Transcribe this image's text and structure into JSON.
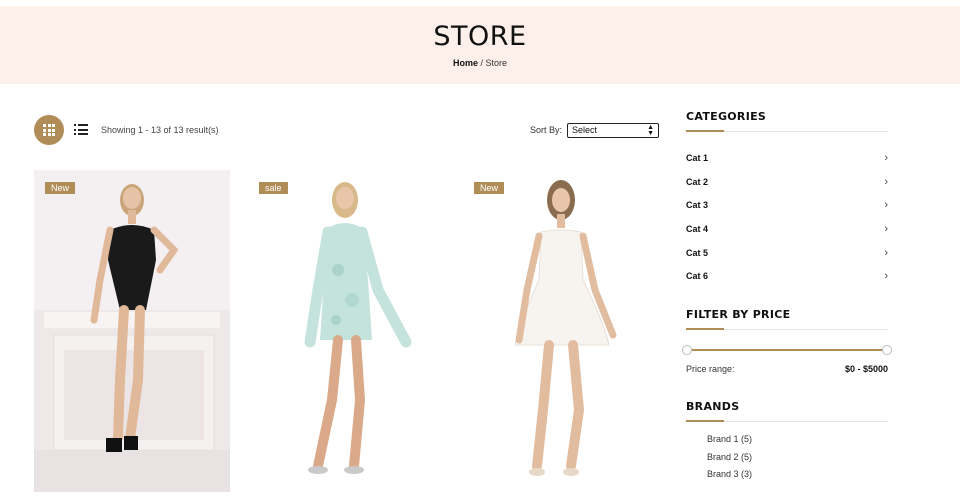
{
  "header": {
    "title": "STORE",
    "breadcrumb_home": "Home",
    "breadcrumb_sep": "/",
    "breadcrumb_current": "Store"
  },
  "toolbar": {
    "result_text": "Showing 1 - 13 of 13 result(s)",
    "sort_label": "Sort By:",
    "sort_value": "Select"
  },
  "products": [
    {
      "badge": "New"
    },
    {
      "badge": "sale"
    },
    {
      "badge": "New"
    }
  ],
  "sidebar": {
    "categories_title": "CATEGORIES",
    "categories": [
      "Cat 1",
      "Cat 2",
      "Cat 3",
      "Cat 4",
      "Cat 5",
      "Cat 6"
    ],
    "price_title": "FILTER BY PRICE",
    "price_label": "Price range:",
    "price_value": "$0 - $5000",
    "price_min": 0,
    "price_max": 5000,
    "brands_title": "BRANDS",
    "brands": [
      "Brand 1 (5)",
      "Brand 2 (5)",
      "Brand 3 (3)"
    ]
  },
  "colors": {
    "accent": "#b08d57",
    "hero_bg": "#fdf0eb"
  }
}
